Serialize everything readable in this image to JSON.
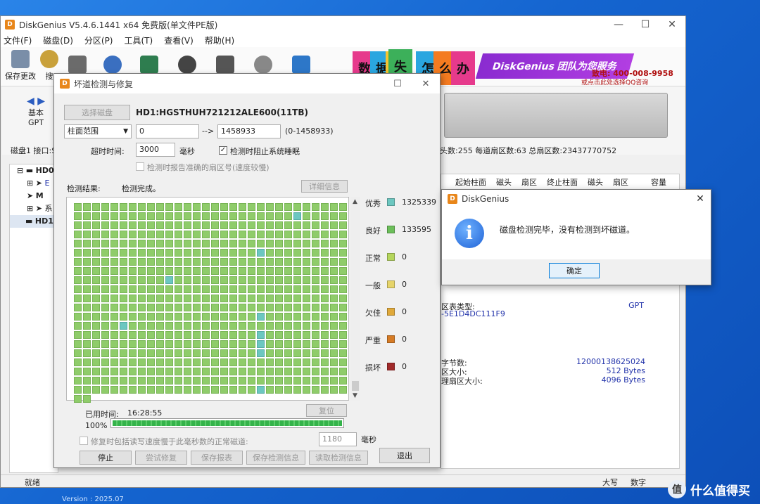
{
  "main": {
    "title": "DiskGenius V5.4.6.1441 x64 免费版(单文件PE版)",
    "win_min": "—",
    "win_max": "☐",
    "win_close": "✕",
    "menu": [
      "文件(F)",
      "磁盘(D)",
      "分区(P)",
      "工具(T)",
      "查看(V)",
      "帮助(H)"
    ],
    "toolbar": [
      {
        "label": "保存更改",
        "icon": "save-icon",
        "color": "#7a8ea8"
      },
      {
        "label": "搜",
        "icon": "search-icon",
        "color": "#c9a13b"
      }
    ],
    "banner": {
      "tiles": [
        "数",
        "据",
        "丢",
        "失",
        "怎",
        "么",
        "办"
      ],
      "tile_colors": [
        "#e63a8c",
        "#2aa6e0",
        "#f4c430",
        "#3cb05a",
        "#2aa6e0",
        "#f47b20",
        "#e63a8c"
      ],
      "slogan": "DiskGenius 团队为您服务",
      "phone": "致电: 400-008-9958",
      "qq": "或点击此处选择QQ咨询"
    },
    "disk_panel": {
      "basic": "基本",
      "gpt": "GPT",
      "info_left": "磁盘1 接口:S",
      "info_right": "头数:255  每道扇区数:63  总扇区数:23437770752"
    },
    "tree": [
      "HD0",
      "E",
      "M",
      "系",
      "HD1"
    ],
    "columns": [
      "起始柱面",
      "磁头",
      "扇区",
      "终止柱面",
      "磁头",
      "扇区",
      "容量"
    ],
    "details": [
      {
        "k": "区表类型:",
        "v": "GPT"
      },
      {
        "k": "-5E1D4DC111F9",
        "v": ""
      },
      {
        "k": "字节数:",
        "v": "12000138625024"
      },
      {
        "k": "区大小:",
        "v": "512 Bytes"
      },
      {
        "k": "理扇区大小:",
        "v": "4096 Bytes"
      }
    ],
    "status": {
      "left": "就绪",
      "caps": "大写",
      "num": "数字"
    }
  },
  "scan_dialog": {
    "title": "坏道检测与修复",
    "select_disk_btn": "选择磁盘",
    "disk_name": "HD1:HGSTHUH721212ALE600(11TB)",
    "range_type": "柱面范围",
    "range_start": "0",
    "range_arrow": "-->",
    "range_end": "1458933",
    "range_total": "(0-1458933)",
    "timeout_label": "超时时间:",
    "timeout_value": "3000",
    "timeout_unit": "毫秒",
    "prevent_sleep": "检测时阻止系统睡眠",
    "report_exact": "检测时报告准确的扇区号(速度较慢)",
    "result_label": "检测结果:",
    "result_text": "检测完成。",
    "detail_btn": "详细信息",
    "legend": [
      {
        "label": "优秀",
        "color": "#6cc7c0",
        "count": "1325339"
      },
      {
        "label": "良好",
        "color": "#6cbf5a",
        "count": "133595"
      },
      {
        "label": "正常",
        "color": "#b5d65c",
        "count": "0"
      },
      {
        "label": "一般",
        "color": "#e6d46a",
        "count": "0"
      },
      {
        "label": "欠佳",
        "color": "#e0a93a",
        "count": "0"
      },
      {
        "label": "严重",
        "color": "#d67b25",
        "count": "0"
      },
      {
        "label": "损坏",
        "color": "#a12a2a",
        "count": "0"
      }
    ],
    "elapsed_label": "已用时间:",
    "elapsed_value": "16:28:55",
    "reset_btn": "复位",
    "progress_percent": "100%",
    "progress_value": 1.0,
    "repair_option": "修复时包括读写速度慢于此毫秒数的正常磁道:",
    "repair_ms": "1180",
    "repair_unit": "毫秒",
    "buttons": [
      "停止",
      "尝试修复",
      "保存报表",
      "保存检测信息",
      "读取检测信息",
      "退出"
    ]
  },
  "info_dialog": {
    "title": "DiskGenius",
    "message": "磁盘检测完毕，没有检测到坏磁道。",
    "ok": "确定",
    "close": "✕"
  },
  "desktop": {
    "version": "Version : 2025.07",
    "watermark_badge": "值",
    "watermark": "什么值得买"
  }
}
